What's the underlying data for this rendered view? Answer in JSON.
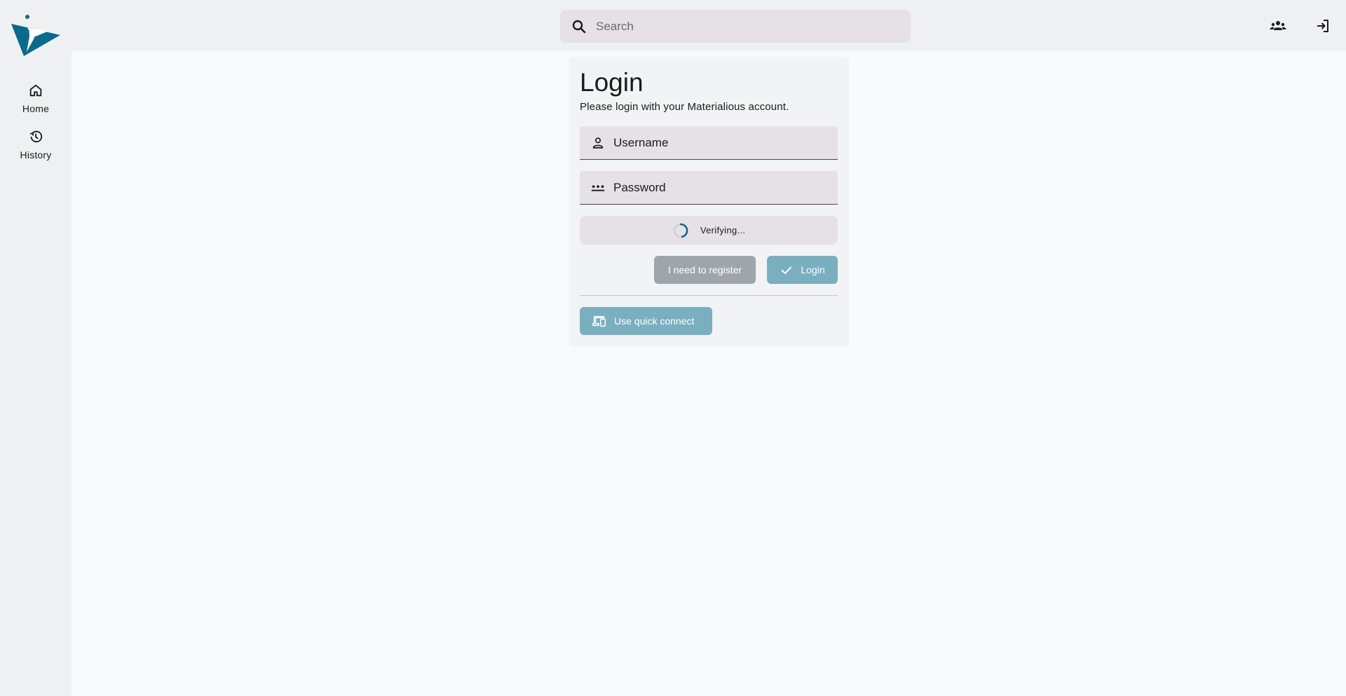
{
  "sidebar": {
    "logo_icon": "app-logo-paper-plane",
    "items": [
      {
        "label": "Home",
        "icon": "home-icon"
      },
      {
        "label": "History",
        "icon": "history-icon"
      }
    ]
  },
  "topbar": {
    "search": {
      "placeholder": "Search",
      "value": ""
    },
    "actions": [
      {
        "icon": "group-icon"
      },
      {
        "icon": "login-icon"
      }
    ]
  },
  "login": {
    "title": "Login",
    "subtitle": "Please login with your Materialious account.",
    "username": {
      "placeholder": "Username",
      "value": ""
    },
    "password": {
      "placeholder": "Password",
      "value": ""
    },
    "status_text": "Verifying...",
    "register_label": "I need to register",
    "login_label": "Login",
    "quick_connect_label": "Use quick connect"
  },
  "colors": {
    "brand": "#0b6a8b",
    "accent_button": "#7aafc0",
    "disabled_button": "#9fa6ab",
    "field_bg": "#e6e1e5",
    "chrome_bg": "#eff0f2",
    "page_bg": "#f8fafb"
  }
}
